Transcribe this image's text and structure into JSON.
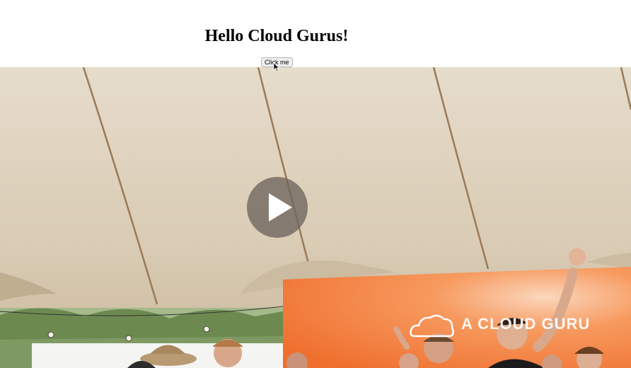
{
  "page": {
    "title": "Hello Cloud Gurus!",
    "button_label": "Click me"
  },
  "video": {
    "play_icon": "play-icon",
    "banner_text": "A CLOUD GURU",
    "banner_color": "#f47a38",
    "tent_color": "#ddd0bc"
  },
  "cursor": {
    "icon": "mouse-pointer-icon"
  }
}
